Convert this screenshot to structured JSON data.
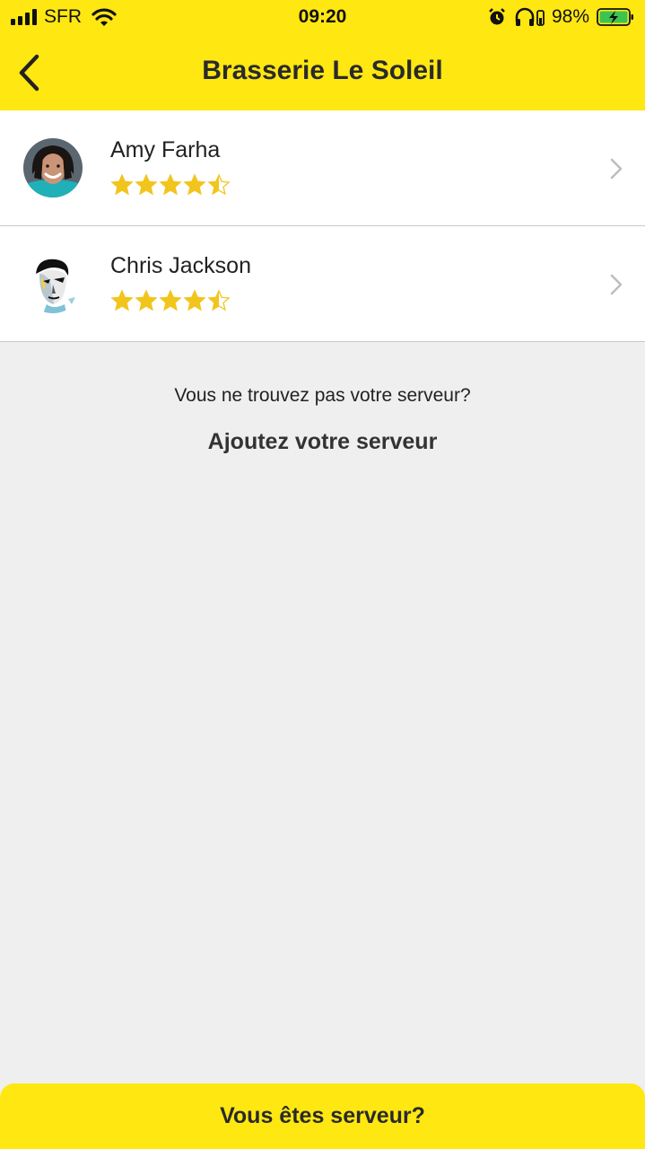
{
  "status_bar": {
    "carrier": "SFR",
    "time": "09:20",
    "battery": "98%",
    "icons": [
      "signal-icon",
      "wifi-icon",
      "alarm-icon",
      "headphones-icon",
      "battery-charging-icon"
    ]
  },
  "nav": {
    "title": "Brasserie Le Soleil",
    "back_icon": "chevron-left-icon"
  },
  "servers": [
    {
      "name": "Amy Farha",
      "rating": 4.5,
      "rating_max": 5
    },
    {
      "name": "Chris Jackson",
      "rating": 4.5,
      "rating_max": 5
    }
  ],
  "empty": {
    "message": "Vous ne trouvez pas votre serveur?",
    "link": "Ajoutez votre serveur"
  },
  "cta": {
    "label": "Vous êtes serveur?"
  },
  "colors": {
    "accent": "#ffe712",
    "star": "#f2c51d",
    "background": "#efefef"
  }
}
